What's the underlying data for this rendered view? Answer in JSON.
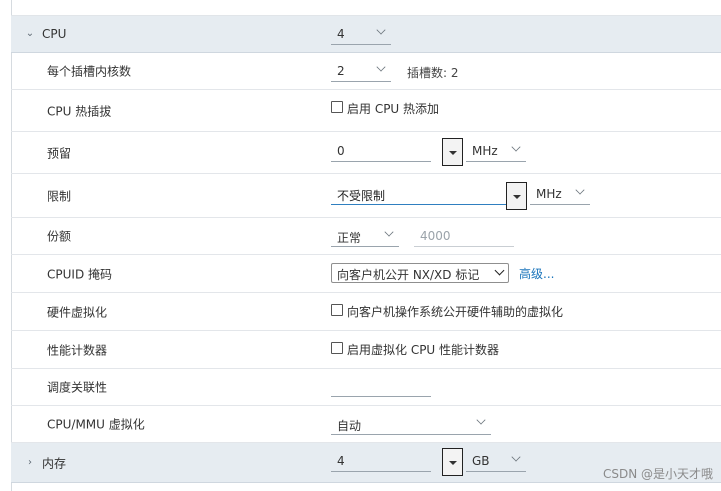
{
  "cpu_section": {
    "label": "CPU",
    "value": "4"
  },
  "rows": {
    "cores_per_socket": {
      "label": "每个插槽内核数",
      "value": "2",
      "sockets_text": "插槽数: 2"
    },
    "cpu_hot_plug": {
      "label": "CPU 热插拔",
      "checkbox_label": "启用 CPU 热添加"
    },
    "reservation": {
      "label": "预留",
      "value": "0",
      "unit": "MHz"
    },
    "limit": {
      "label": "限制",
      "value": "不受限制",
      "unit": "MHz"
    },
    "shares": {
      "label": "份额",
      "level": "正常",
      "value": "4000"
    },
    "cpuid_mask": {
      "label": "CPUID 掩码",
      "value": "向客户机公开 NX/XD 标记",
      "advanced_link": "高级..."
    },
    "hw_virtualization": {
      "label": "硬件虚拟化",
      "checkbox_label": "向客户机操作系统公开硬件辅助的虚拟化"
    },
    "perf_counters": {
      "label": "性能计数器",
      "checkbox_label": "启用虚拟化 CPU 性能计数器"
    },
    "scheduling_affinity": {
      "label": "调度关联性",
      "value": ""
    },
    "cpu_mmu": {
      "label": "CPU/MMU 虚拟化",
      "value": "自动"
    }
  },
  "memory_section": {
    "label": "内存",
    "value": "4",
    "unit": "GB"
  },
  "watermark": "CSDN @是小天才哦",
  "colors": {
    "section_bg": "#e6ecf1",
    "link": "#1b75bb",
    "focus_underline": "#2f7fc0"
  }
}
